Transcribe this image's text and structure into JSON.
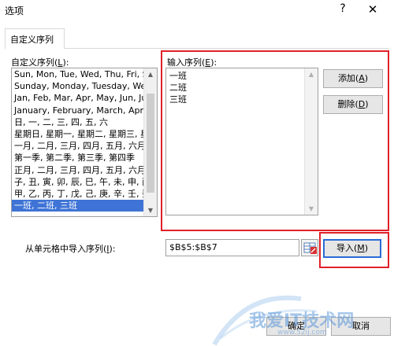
{
  "window": {
    "title": "选项",
    "help_label": "?",
    "close_label": "✕"
  },
  "tabs": [
    {
      "label": "自定义序列"
    }
  ],
  "custom_lists": {
    "label": "自定义序列(",
    "mnemonic": "L",
    "label_end": "):",
    "items": [
      "Sun, Mon, Tue, Wed, Thu, Fri, S",
      "Sunday, Monday, Tuesday, Wed",
      "Jan, Feb, Mar, Apr, May, Jun, Ju",
      "January, February, March, April,",
      "日, 一, 二, 三, 四, 五, 六",
      "星期日, 星期一, 星期二, 星期三, 星",
      "一月, 二月, 三月, 四月, 五月, 六月,",
      "第一季, 第二季, 第三季, 第四季",
      "正月, 二月, 三月, 四月, 五月, 六月,",
      "子, 丑, 寅, 卯, 辰, 巳, 午, 未, 申, 酉",
      "甲, 乙, 丙, 丁, 戊, 己, 庚, 辛, 壬, 癸",
      "一班, 二班, 三班"
    ],
    "selected_index": 11
  },
  "entries": {
    "label": "输入序列(",
    "mnemonic": "E",
    "label_end": "):",
    "lines": [
      "一班",
      "二班",
      "三班"
    ]
  },
  "buttons": {
    "add": {
      "label": "添加(",
      "mnemonic": "A",
      "end": ")"
    },
    "delete": {
      "label": "删除(",
      "mnemonic": "D",
      "end": ")"
    },
    "import": {
      "label": "导入(",
      "mnemonic": "M",
      "end": ")"
    },
    "ok": {
      "label": "确定"
    },
    "cancel": {
      "label": "取消"
    }
  },
  "import": {
    "label": "从单元格中导入序列(",
    "mnemonic": "I",
    "label_end": "):",
    "value": "$B$5:$B$7"
  },
  "watermark": {
    "text": "我爱IT技术网",
    "url": "www.52ij.com"
  },
  "colors": {
    "highlight": "#e0202a",
    "selection": "#3f74d6",
    "default_button_border": "#2a6bd6"
  }
}
